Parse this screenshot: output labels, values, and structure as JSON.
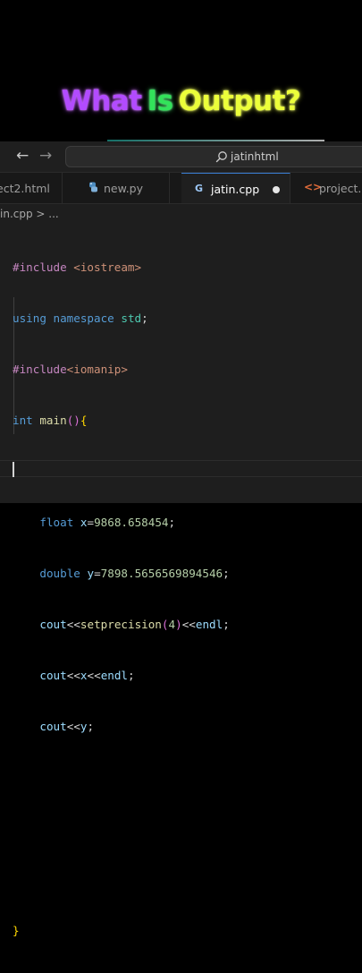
{
  "headline": {
    "word1": "What",
    "word2": "Is",
    "word3": "Output?",
    "colors": {
      "word1": "#b24bff",
      "word2": "#32e35a",
      "word3": "#ecff3a"
    }
  },
  "titlebar": {
    "back_icon": "arrow-left-icon",
    "forward_icon": "arrow-right-icon",
    "search_icon": "search-icon",
    "search_text": "jatinhtml"
  },
  "tabs": [
    {
      "label": "ect2.html",
      "active": false
    },
    {
      "label": "new.py",
      "icon": "python-icon",
      "active": false
    },
    {
      "label": "jatin.cpp",
      "icon": "cpp-icon",
      "active": true,
      "modified": true
    },
    {
      "label": "project.h",
      "icon": "html-icon",
      "active": false
    }
  ],
  "breadcrumb": "in.cpp > ...",
  "code": {
    "lines": [
      "#include <iostream>",
      "using namespace std;",
      "#include<iomanip>",
      "int main(){",
      "",
      "    float x=9868.658454;",
      "    double y=7898.5656569894546;",
      "    cout<<setprecision(4)<<endl;",
      "    cout<<x<<endl;",
      "    cout<<y;",
      "",
      "",
      "",
      "}"
    ]
  },
  "theme": {
    "background": "#1e1e1e",
    "keyword": "#569cd6",
    "preprocessor": "#c586c0",
    "string": "#ce9178",
    "number": "#b5cea8",
    "function": "#dcdcaa",
    "variable": "#9cdcfe",
    "active_tab_border": "#3a7fd6"
  }
}
